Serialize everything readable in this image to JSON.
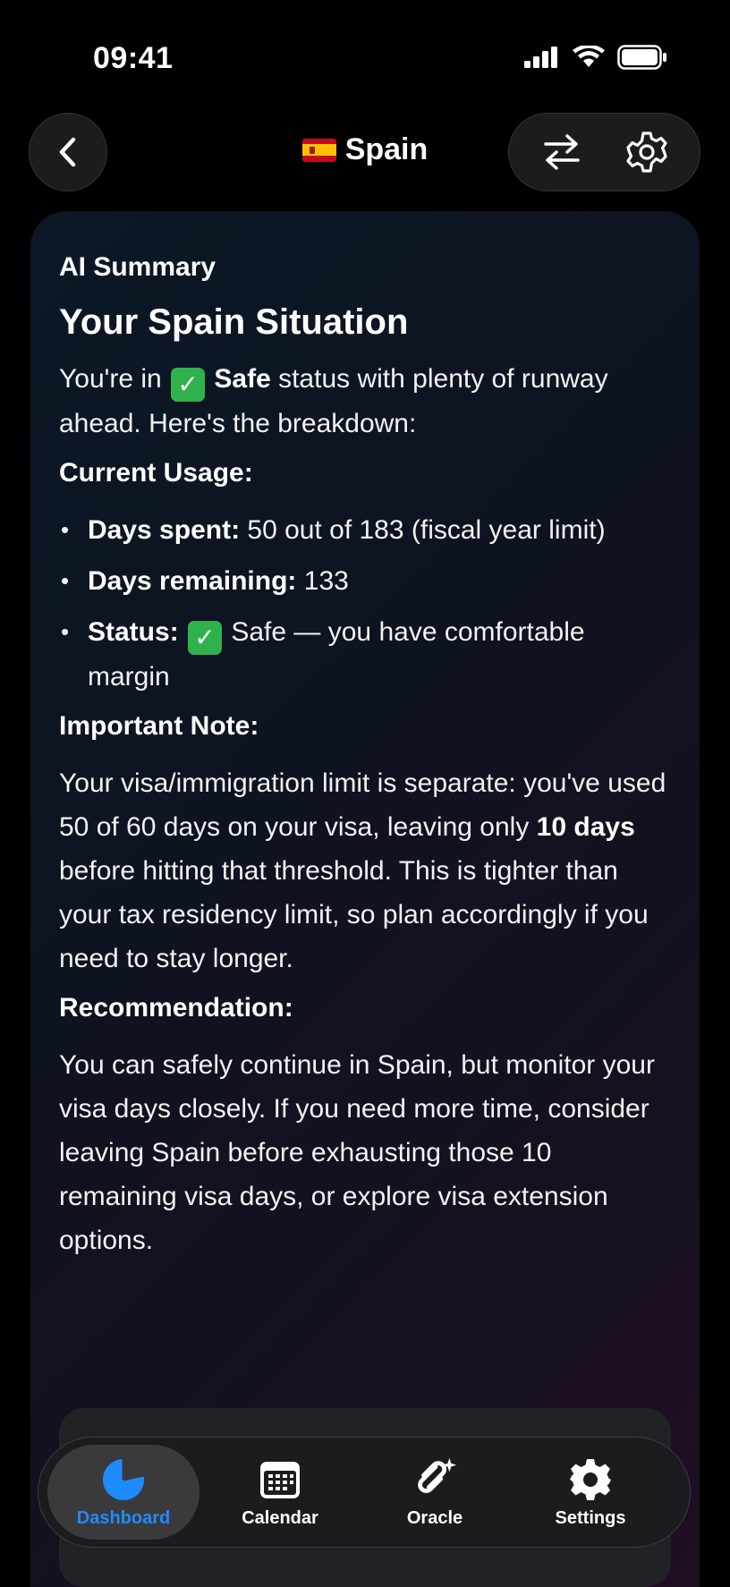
{
  "status_bar": {
    "time": "09:41"
  },
  "header": {
    "title": "Spain",
    "back_icon": "chevron-left-icon",
    "actions": [
      "swap-arrows-icon",
      "gear-icon"
    ]
  },
  "summary": {
    "label": "AI Summary",
    "heading": "Your Spain Situation",
    "intro": {
      "before": "You're in ",
      "status_word": "Safe",
      "after": " status with plenty of runway ahead. Here's the breakdown:"
    },
    "usage_heading": "Current Usage:",
    "usage_items": [
      {
        "label": "Days spent:",
        "text": " 50 out of 183 (fiscal year limit)"
      },
      {
        "label": "Days remaining:",
        "text": " 133"
      },
      {
        "label": "Status:",
        "text": " Safe — you have comfortable margin"
      }
    ],
    "note_heading": "Important Note:",
    "note": {
      "before": "Your visa/immigration limit is separate: you've used 50 of 60 days on your visa, leaving only ",
      "bold": "10 days",
      "after": " before hitting that threshold. This is tighter than your tax residency limit, so plan accordingly if you need to stay longer."
    },
    "recommendation_heading": "Recommendation:",
    "recommendation": "You can safely continue in Spain, but monitor your visa days closely. If you need more time, consider leaving Spain before exhausting those 10 remaining visa days, or explore visa extension options."
  },
  "tab_bar": {
    "active": "Dashboard",
    "tabs": [
      {
        "label": "Dashboard",
        "icon": "pie-chart-icon"
      },
      {
        "label": "Calendar",
        "icon": "calendar-icon"
      },
      {
        "label": "Oracle",
        "icon": "oracle-sparkle-icon"
      },
      {
        "label": "Settings",
        "icon": "gear-icon"
      }
    ]
  },
  "colors": {
    "accent": "#1e8cff",
    "safe_check": "#2fb24c",
    "card_gradient_start": "#0c1826",
    "card_gradient_end": "#1e0f22"
  }
}
